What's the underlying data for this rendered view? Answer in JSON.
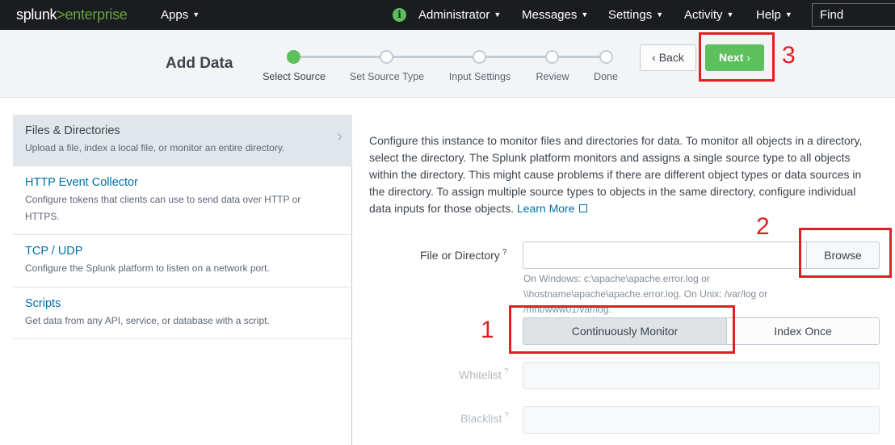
{
  "topbar": {
    "logo_splunk": "splunk",
    "logo_gt": ">",
    "logo_enterprise": "enterprise",
    "apps": "Apps",
    "info_icon": "i",
    "administrator": "Administrator",
    "messages": "Messages",
    "settings": "Settings",
    "activity": "Activity",
    "help": "Help",
    "find_placeholder": "Find"
  },
  "header": {
    "title": "Add Data",
    "steps": [
      {
        "label": "Select Source",
        "active": true
      },
      {
        "label": "Set Source Type",
        "active": false
      },
      {
        "label": "Input Settings",
        "active": false
      },
      {
        "label": "Review",
        "active": false
      },
      {
        "label": "Done",
        "active": false
      }
    ],
    "back_label": "Back",
    "next_label": "Next",
    "back_chevron": "‹",
    "next_chevron": "›"
  },
  "sources": [
    {
      "title": "Files & Directories",
      "desc": "Upload a file, index a local file, or monitor an entire directory.",
      "selected": true
    },
    {
      "title": "HTTP Event Collector",
      "desc": "Configure tokens that clients can use to send data over HTTP or HTTPS.",
      "selected": false
    },
    {
      "title": "TCP / UDP",
      "desc": "Configure the Splunk platform to listen on a network port.",
      "selected": false
    },
    {
      "title": "Scripts",
      "desc": "Get data from any API, service, or database with a script.",
      "selected": false
    }
  ],
  "main": {
    "description": "Configure this instance to monitor files and directories for data. To monitor all objects in a directory, select the directory. The Splunk platform monitors and assigns a single source type to all objects within the directory. This might cause problems if there are different object types or data sources in the directory. To assign multiple source types to objects in the same directory, configure individual data inputs for those objects.",
    "learn_more": "Learn More",
    "file_label": "File or Directory",
    "help_mark": "?",
    "file_value": "",
    "browse_label": "Browse",
    "help_text": "On Windows: c:\\apache\\apache.error.log or \\\\hostname\\apache\\apache.error.log. On Unix: /var/log or /mnt/www01/var/log.",
    "continuously_monitor": "Continuously Monitor",
    "index_once": "Index Once",
    "whitelist_label": "Whitelist",
    "blacklist_label": "Blacklist"
  },
  "annotations": {
    "one": "1",
    "two": "2",
    "three": "3",
    "color": "#e01e24"
  },
  "colors": {
    "accent_green": "#5cc05c",
    "link_blue": "#006eaa",
    "nav_bg": "#1a1c20"
  }
}
